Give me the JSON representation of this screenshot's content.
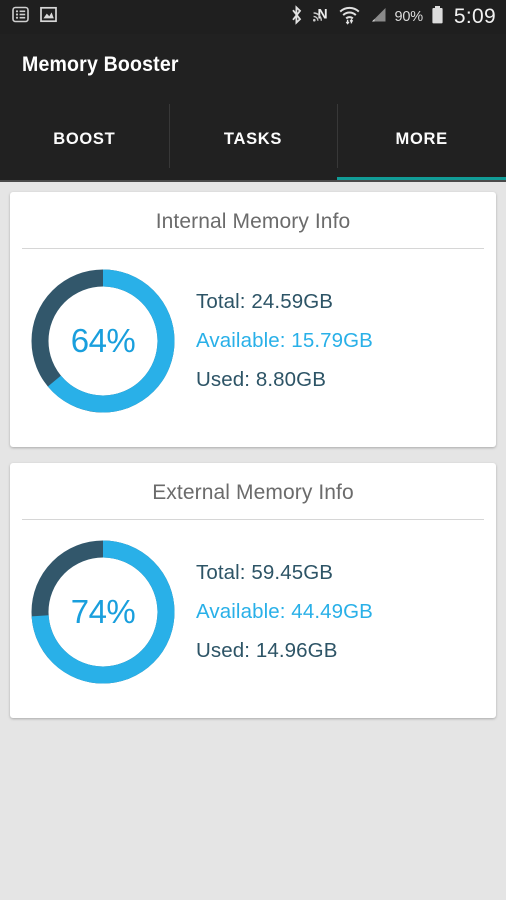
{
  "statusbar": {
    "left_icons": [
      {
        "name": "notification-list-icon"
      },
      {
        "name": "image-notification-icon"
      }
    ],
    "right_icons": [
      {
        "name": "bluetooth-icon"
      },
      {
        "name": "nfc-icon"
      },
      {
        "name": "wifi-icon"
      },
      {
        "name": "cellular-signal-icon"
      }
    ],
    "battery_percent": "90%",
    "battery_icon": "battery-icon",
    "clock": "5:09"
  },
  "header": {
    "title": "Memory Booster"
  },
  "tabs": {
    "items": [
      {
        "label": "BOOST",
        "active": false
      },
      {
        "label": "TASKS",
        "active": false
      },
      {
        "label": "MORE",
        "active": true
      }
    ],
    "active_index": 2,
    "indicator_color": "#119c97"
  },
  "colors": {
    "accent_blue": "#29b0e8",
    "donut_track": "#32576b",
    "text_dark": "#2d5466",
    "card_title": "#6b6b6b",
    "page_bg": "#e5e5e5"
  },
  "cards": [
    {
      "title": "Internal Memory Info",
      "percent_label": "64%",
      "percent_value": 64,
      "stats": [
        {
          "label": "Total: 24.59GB",
          "kind": "total"
        },
        {
          "label": "Available: 15.79GB",
          "kind": "available"
        },
        {
          "label": "Used: 8.80GB",
          "kind": "used"
        }
      ]
    },
    {
      "title": "External Memory Info",
      "percent_label": "74%",
      "percent_value": 74,
      "stats": [
        {
          "label": "Total: 59.45GB",
          "kind": "total"
        },
        {
          "label": "Available: 44.49GB",
          "kind": "available"
        },
        {
          "label": "Used: 14.96GB",
          "kind": "used"
        }
      ]
    }
  ],
  "chart_data": [
    {
      "type": "pie",
      "title": "Internal Memory Info",
      "categories": [
        "Available",
        "Used"
      ],
      "values": [
        15.79,
        8.8
      ],
      "unit": "GB",
      "total": 24.59,
      "percent_shown": 64,
      "percent_meaning": "available share of total",
      "colors": [
        "#29b0e8",
        "#32576b"
      ],
      "legend": "right",
      "grid": false
    },
    {
      "type": "pie",
      "title": "External Memory Info",
      "categories": [
        "Available",
        "Used"
      ],
      "values": [
        44.49,
        14.96
      ],
      "unit": "GB",
      "total": 59.45,
      "percent_shown": 74,
      "percent_meaning": "available share of total",
      "colors": [
        "#29b0e8",
        "#32576b"
      ],
      "legend": "right",
      "grid": false
    }
  ]
}
